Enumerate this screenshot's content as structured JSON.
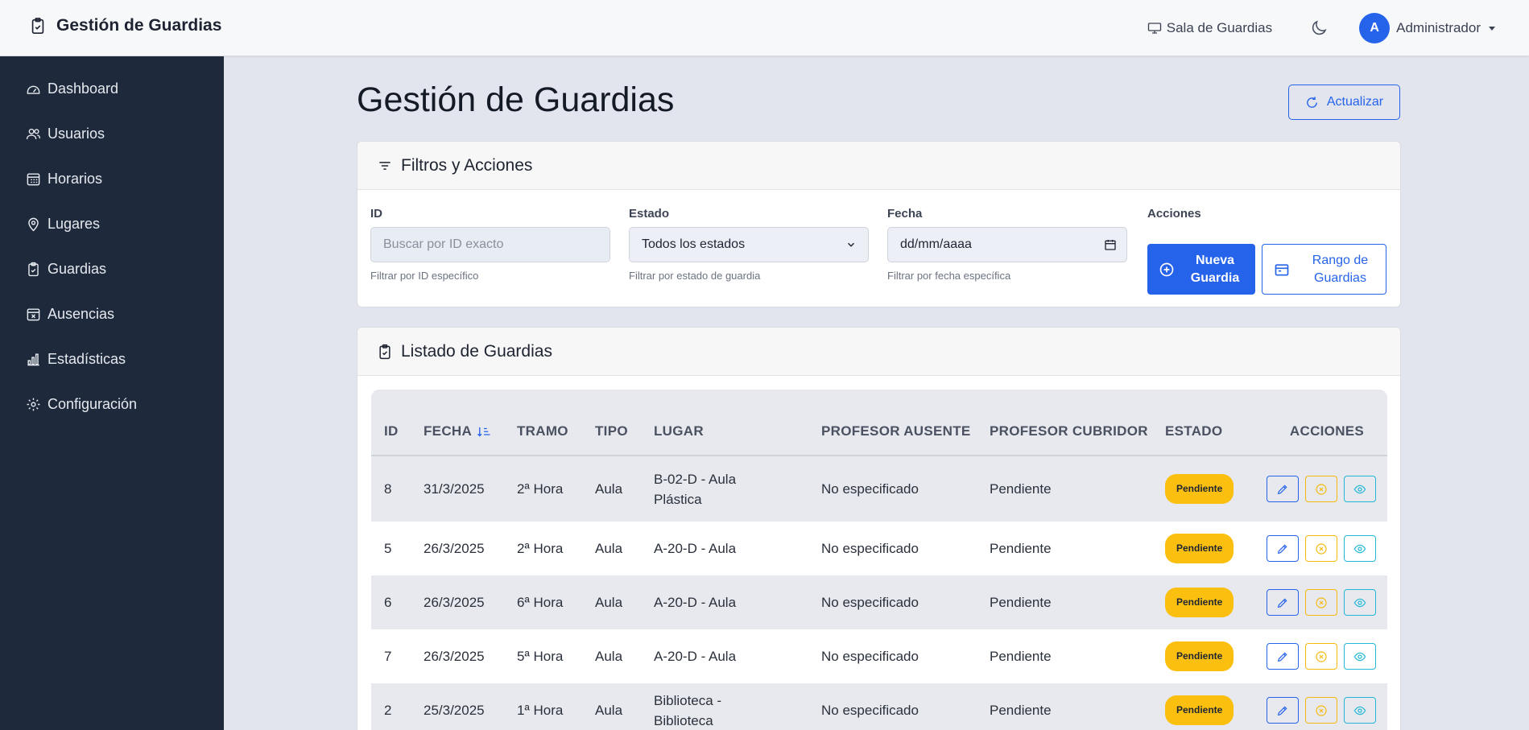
{
  "app": {
    "brand": "Gestión de Guardias",
    "sala_link": "Sala de Guardias",
    "user": {
      "initial": "A",
      "name": "Administrador"
    }
  },
  "sidebar": {
    "items": [
      {
        "label": "Dashboard",
        "icon": "dashboard-icon"
      },
      {
        "label": "Usuarios",
        "icon": "users-icon"
      },
      {
        "label": "Horarios",
        "icon": "calendar-grid-icon"
      },
      {
        "label": "Lugares",
        "icon": "map-pin-icon"
      },
      {
        "label": "Guardias",
        "icon": "clipboard-check-icon"
      },
      {
        "label": "Ausencias",
        "icon": "calendar-x-icon"
      },
      {
        "label": "Estadísticas",
        "icon": "bar-chart-icon"
      },
      {
        "label": "Configuración",
        "icon": "gear-icon"
      }
    ]
  },
  "page": {
    "title": "Gestión de Guardias",
    "refresh_label": "Actualizar"
  },
  "filters": {
    "title": "Filtros y Acciones",
    "id": {
      "label": "ID",
      "placeholder": "Buscar por ID exacto",
      "help": "Filtrar por ID específico"
    },
    "estado": {
      "label": "Estado",
      "value": "Todos los estados",
      "help": "Filtrar por estado de guardia"
    },
    "fecha": {
      "label": "Fecha",
      "value": "dd/mm/aaaa",
      "help": "Filtrar por fecha específica"
    },
    "acciones": {
      "label": "Acciones",
      "new_label": "Nueva Guardia",
      "range_label": "Rango de Guardias"
    }
  },
  "listado": {
    "title": "Listado de Guardias",
    "columns": {
      "id": "ID",
      "fecha": "FECHA",
      "tramo": "TRAMO",
      "tipo": "TIPO",
      "lugar": "LUGAR",
      "ausente": "PROFESOR AUSENTE",
      "cubridor": "PROFESOR CUBRIDOR",
      "estado": "ESTADO",
      "acciones": "ACCIONES"
    },
    "rows": [
      {
        "id": "8",
        "fecha": "31/3/2025",
        "tramo": "2ª Hora",
        "tipo": "Aula",
        "lugar": "B-02-D - Aula Plástica",
        "ausente": "No especificado",
        "cubridor": "Pendiente",
        "estado": "Pendiente"
      },
      {
        "id": "5",
        "fecha": "26/3/2025",
        "tramo": "2ª Hora",
        "tipo": "Aula",
        "lugar": "A-20-D - Aula",
        "ausente": "No especificado",
        "cubridor": "Pendiente",
        "estado": "Pendiente"
      },
      {
        "id": "6",
        "fecha": "26/3/2025",
        "tramo": "6ª Hora",
        "tipo": "Aula",
        "lugar": "A-20-D - Aula",
        "ausente": "No especificado",
        "cubridor": "Pendiente",
        "estado": "Pendiente"
      },
      {
        "id": "7",
        "fecha": "26/3/2025",
        "tramo": "5ª Hora",
        "tipo": "Aula",
        "lugar": "A-20-D - Aula",
        "ausente": "No especificado",
        "cubridor": "Pendiente",
        "estado": "Pendiente"
      },
      {
        "id": "2",
        "fecha": "25/3/2025",
        "tramo": "1ª Hora",
        "tipo": "Aula",
        "lugar": "Biblioteca - Biblioteca",
        "ausente": "No especificado",
        "cubridor": "Pendiente",
        "estado": "Pendiente"
      }
    ]
  },
  "colors": {
    "primary": "#2563eb",
    "sidebar_bg": "#1e293b",
    "badge_pending": "#fbbf0f",
    "warning": "#f5b90e",
    "info": "#22b8d6"
  }
}
